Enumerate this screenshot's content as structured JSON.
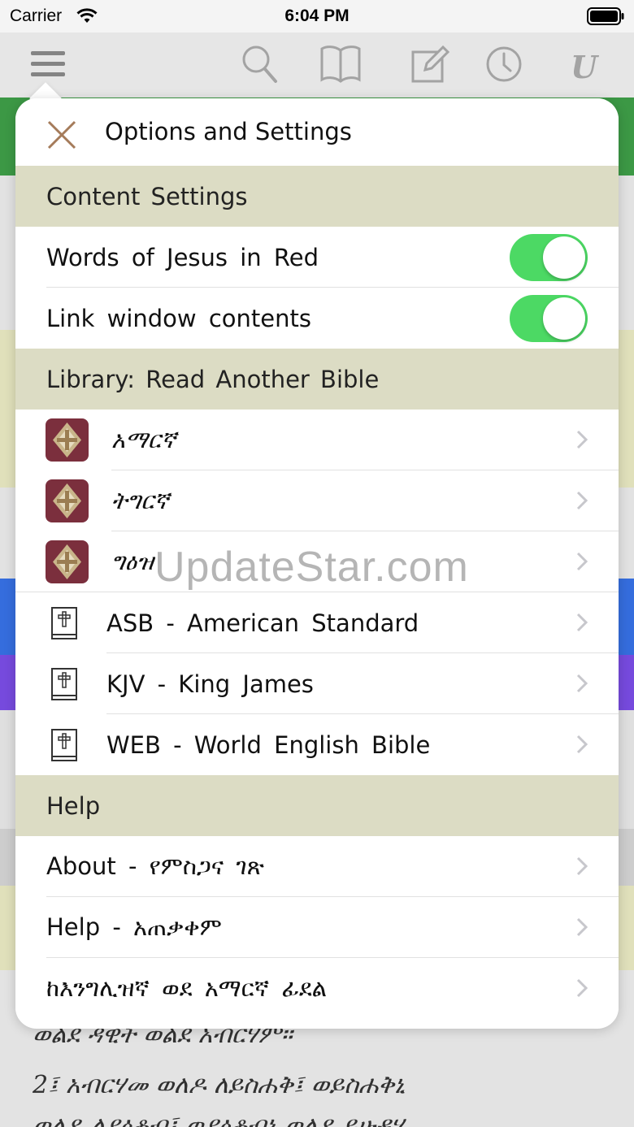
{
  "status_bar": {
    "carrier": "Carrier",
    "time": "6:04 PM"
  },
  "toolbar": {
    "icons": [
      "menu-icon",
      "search-icon",
      "book-icon",
      "edit-icon",
      "history-icon",
      "u-logo-icon"
    ],
    "u_logo_text": "U"
  },
  "background_text": {
    "line1": "ወልደ ዳዊት ወልደ አብርሃም።",
    "line2": "2፤ አብርሃመ ወለዶ ለይስሐቅ፤ ወይስሐቅኒ",
    "line3": "ወለዶ ለያዕቆብ፤ ወያዕቆብኒ ወለዶ ይሁዳሃ"
  },
  "panel": {
    "title": "Options and Settings",
    "content_settings": {
      "header": "Content Settings",
      "rows": [
        {
          "label": "Words of Jesus in Red",
          "on": true
        },
        {
          "label": "Link window contents",
          "on": true
        }
      ]
    },
    "library": {
      "header": "Library: Read Another Bible",
      "rows": [
        {
          "label": "አማርኛ",
          "icon": "ethiopian-cross-icon"
        },
        {
          "label": "ትግርኛ",
          "icon": "ethiopian-cross-icon"
        },
        {
          "label": "ግዕዝ",
          "icon": "ethiopian-cross-icon"
        },
        {
          "label": "ASB - American Standard",
          "icon": "bible-book-icon"
        },
        {
          "label": "KJV - King James",
          "icon": "bible-book-icon"
        },
        {
          "label": "WEB - World English Bible",
          "icon": "bible-book-icon"
        }
      ]
    },
    "help": {
      "header": "Help",
      "rows": [
        {
          "label": "About - የምስጋና ገጽ"
        },
        {
          "label": "Help - አጠቃቀም"
        },
        {
          "label": "ከእንግሊዝኛ ወደ አማርኛ ፊደል"
        }
      ]
    }
  },
  "watermark": "UpdateStar.com",
  "colors": {
    "section_header_bg": "#dcdcc4",
    "toggle_on": "#4cd964",
    "close_icon": "#a57b5a",
    "bible_icon_bg": "#7b2f3d",
    "band_green": "#3f9f48",
    "band_yellow": "#eaeac3",
    "band_blue": "#3872e6",
    "band_purple": "#7b4ee6"
  }
}
